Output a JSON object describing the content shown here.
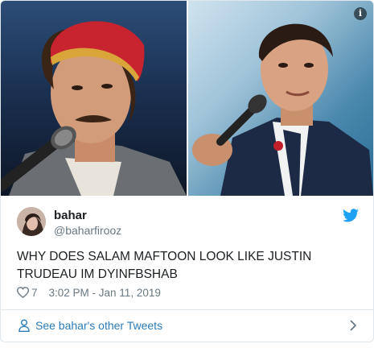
{
  "tweet": {
    "author_name": "bahar",
    "author_handle": "@baharfirooz",
    "text": "WHY DOES SALAM MAFTOON LOOK LIKE JUSTIN TRUDEAU IM DYINFBSHAB",
    "like_count": "7",
    "timestamp": "3:02 PM - Jan 11, 2019"
  },
  "media": {
    "left_photo": "man-with-red-hat-singing-icon",
    "right_photo": "man-in-suit-speaking-icon",
    "info_glyph": "i"
  },
  "footer": {
    "label": "See bahar's other Tweets"
  },
  "icons": {
    "bird": "twitter-bird-icon",
    "heart": "heart-icon",
    "person": "person-icon",
    "chevron": "chevron-right-icon"
  },
  "colors": {
    "brand_blue": "#1da1f2",
    "link_blue": "#2b7bb9",
    "text": "#1c2022",
    "muted": "#697882",
    "border": "#e1e8ed"
  }
}
